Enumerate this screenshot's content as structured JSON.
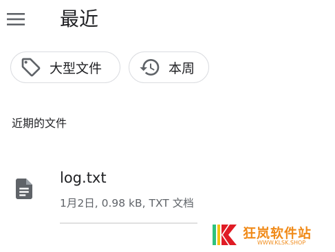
{
  "header": {
    "title": "最近",
    "menu_icon": "hamburger-menu-icon"
  },
  "chips": [
    {
      "label": "大型文件",
      "icon": "tag-icon"
    },
    {
      "label": "本周",
      "icon": "history-icon"
    }
  ],
  "section": {
    "title": "近期的文件"
  },
  "files": [
    {
      "name": "log.txt",
      "meta": "1月2日, 0.98 kB, TXT 文档",
      "icon": "document-icon"
    }
  ],
  "watermark": {
    "text": "狂岚软件站",
    "url": "WWW.KLSK.SHOP"
  },
  "colors": {
    "icon": "#5f6368",
    "chip_border": "#dadce0",
    "watermark": "#f08a18"
  }
}
